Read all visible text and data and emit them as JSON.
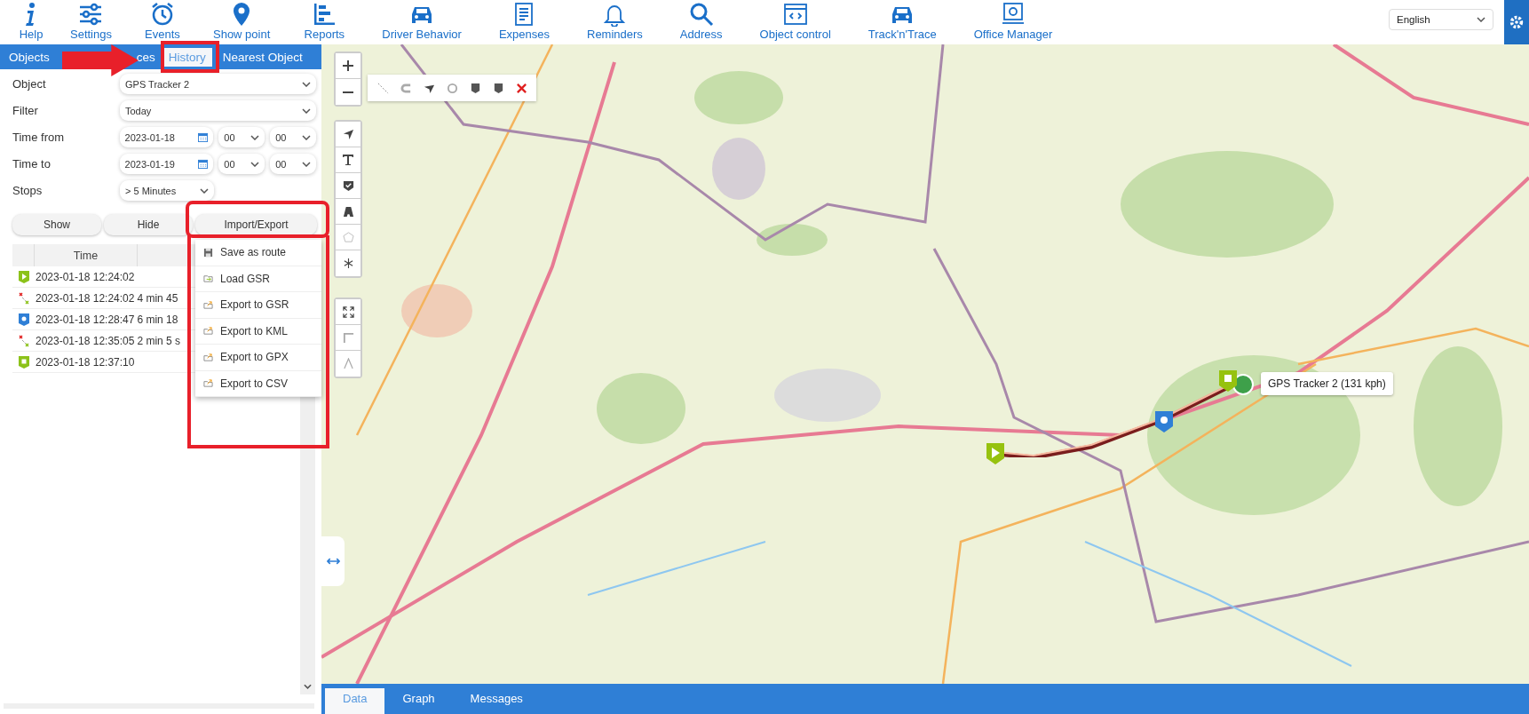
{
  "toolbar": {
    "items": [
      {
        "label": "Help"
      },
      {
        "label": "Settings"
      },
      {
        "label": "Events"
      },
      {
        "label": "Show point"
      },
      {
        "label": "Reports"
      },
      {
        "label": "Driver Behavior"
      },
      {
        "label": "Expenses"
      },
      {
        "label": "Reminders"
      },
      {
        "label": "Address"
      },
      {
        "label": "Object control"
      },
      {
        "label": "Track'n'Trace"
      },
      {
        "label": "Office Manager"
      }
    ],
    "language": "English"
  },
  "panel_tabs": [
    {
      "label": "Objects",
      "selected": false
    },
    {
      "label": "ces",
      "selected": false
    },
    {
      "label": "History",
      "selected": true
    },
    {
      "label": "Nearest Object",
      "selected": false
    }
  ],
  "form": {
    "object": {
      "label": "Object",
      "value": "GPS Tracker 2"
    },
    "filter": {
      "label": "Filter",
      "value": "Today"
    },
    "time_from": {
      "label": "Time from",
      "date": "2023-01-18",
      "hour": "00",
      "minute": "00"
    },
    "time_to": {
      "label": "Time to",
      "date": "2023-01-19",
      "hour": "00",
      "minute": "00"
    },
    "stops": {
      "label": "Stops",
      "value": "> 5 Minutes"
    }
  },
  "buttons": [
    "Show",
    "Hide",
    "Import/Export"
  ],
  "table": {
    "columns": [
      "Time"
    ],
    "rows": [
      {
        "kind": "start",
        "time": "2023-01-18 12:24:02",
        "duration": ""
      },
      {
        "kind": "move",
        "time": "2023-01-18 12:24:02",
        "duration": "4 min 45"
      },
      {
        "kind": "parking",
        "time": "2023-01-18 12:28:47",
        "duration": "6 min 18"
      },
      {
        "kind": "move",
        "time": "2023-01-18 12:35:05",
        "duration": "2 min 5 s"
      },
      {
        "kind": "stop",
        "time": "2023-01-18 12:37:10",
        "duration": ""
      }
    ]
  },
  "menu": [
    {
      "kind": "save",
      "label": "Save as route"
    },
    {
      "kind": "load",
      "label": "Load GSR"
    },
    {
      "kind": "export",
      "label": "Export to GSR"
    },
    {
      "kind": "export",
      "label": "Export to KML"
    },
    {
      "kind": "export",
      "label": "Export to GPX"
    },
    {
      "kind": "export",
      "label": "Export to CSV"
    }
  ],
  "map": {
    "tooltip": "GPS Tracker 2 (131 kph)"
  },
  "bottom_tabs": [
    {
      "label": "Data",
      "selected": true
    },
    {
      "label": "Graph",
      "selected": false
    },
    {
      "label": "Messages",
      "selected": false
    }
  ]
}
